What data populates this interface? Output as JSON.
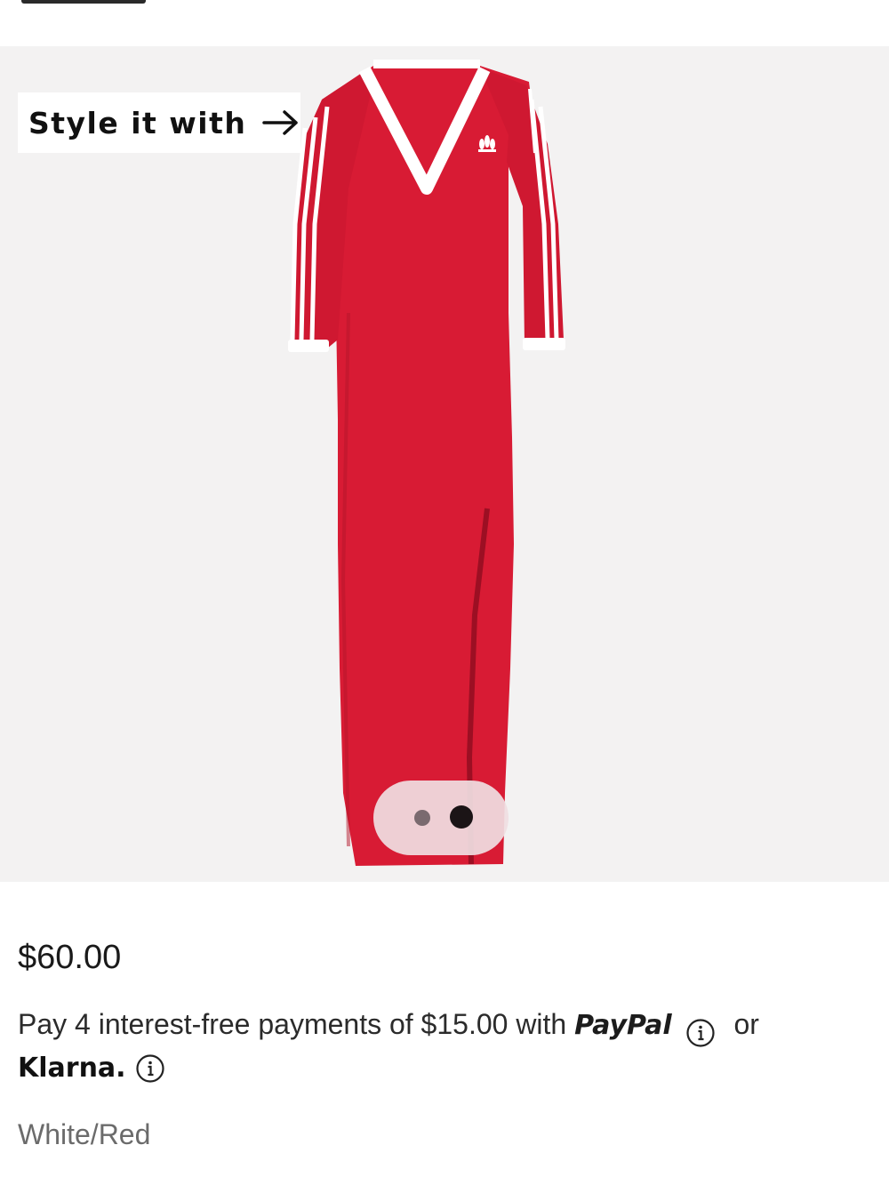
{
  "gallery": {
    "style_chip": {
      "label": "Style it with",
      "icon": "arrow-right-icon"
    },
    "image_alt": "Red adidas maxi dress with white V-neck and three stripes on sleeves",
    "carousel": {
      "count": 2,
      "active_index": 1
    }
  },
  "product": {
    "price": "$60.00",
    "installments": {
      "text_before": "Pay 4 interest-free payments of $15.00 with",
      "paypal_brand": "PayPal",
      "or_text": "or",
      "klarna_brand": "Klarna.",
      "info_icon": "info-icon"
    },
    "color_name": "White/Red"
  },
  "colors": {
    "dress_red": "#d81b34",
    "gallery_bg": "#f3f2f2",
    "stripe_white": "#ffffff"
  }
}
